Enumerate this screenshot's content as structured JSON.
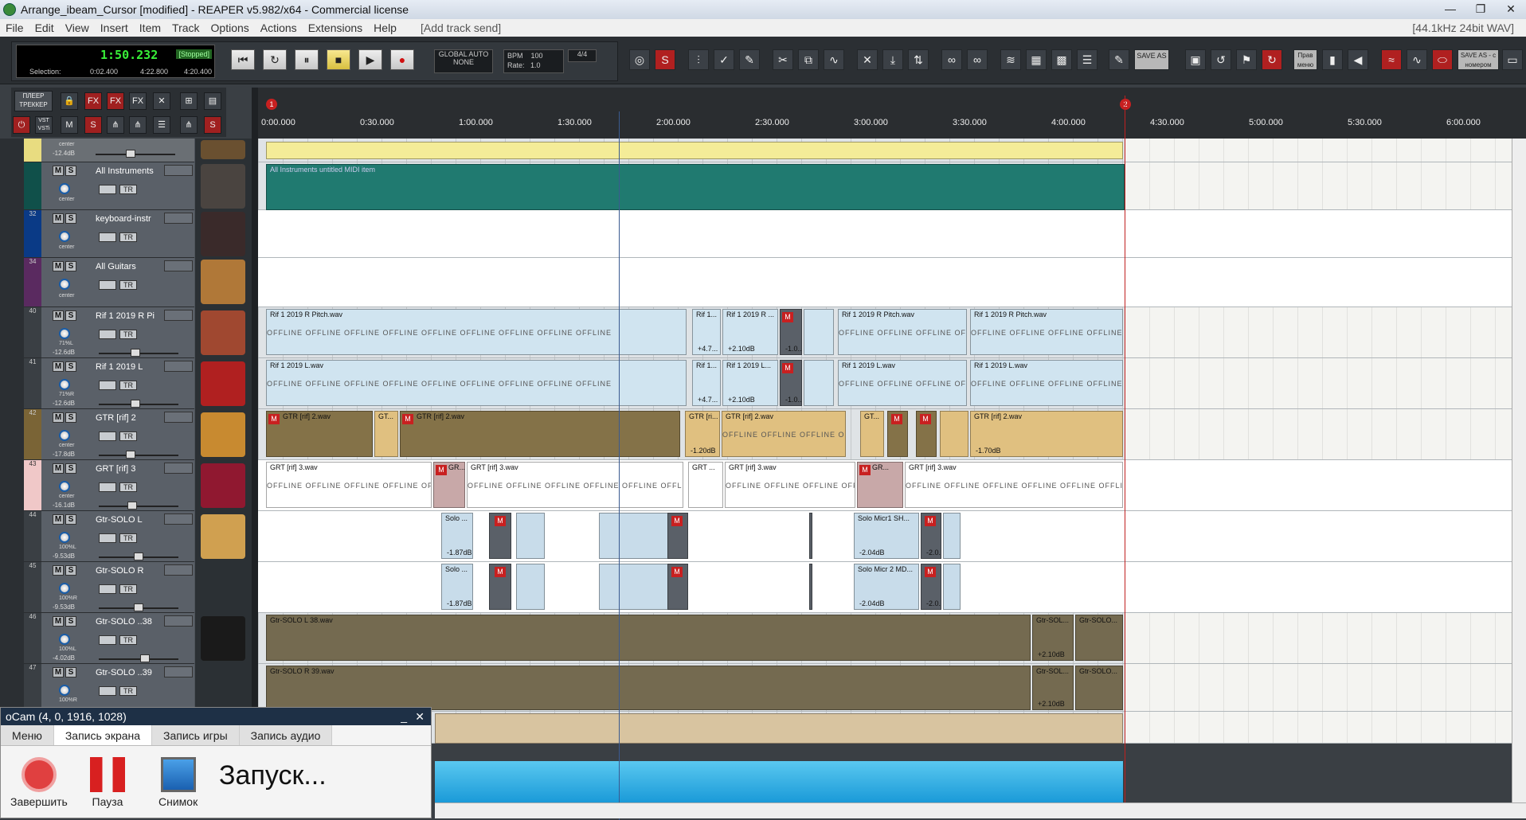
{
  "window": {
    "title": "Arrange_ibeam_Cursor [modified] - REAPER v5.982/x64 - Commercial license",
    "controls": [
      "—",
      "❐",
      "✕"
    ]
  },
  "menu": {
    "items": [
      "File",
      "Edit",
      "View",
      "Insert",
      "Item",
      "Track",
      "Options",
      "Actions",
      "Extensions",
      "Help"
    ],
    "send": "[Add track send]",
    "format": "[44.1kHz 24bit WAV]"
  },
  "transport": {
    "time": "1:50.232",
    "state": "[Stopped]",
    "sel_label": "Selection:",
    "sel_start": "0:02.400",
    "sel_end": "4:22.800",
    "sel_len": "4:20.400",
    "global_auto": "GLOBAL AUTO",
    "auto_mode": "NONE",
    "bpm_label": "BPM",
    "bpm": "100",
    "rate_label": "Rate:",
    "rate": "1.0",
    "signature": "4/4"
  },
  "toolbar": {
    "save_as": "SAVE AS",
    "prev_menu": "Прав меню",
    "save_as_num": "SAVE AS - с номером"
  },
  "lefttools": {
    "tracker": "ПЛЕЕР ТРЕККЕР",
    "vsti": "VST VSTi"
  },
  "ruler": {
    "marks": [
      "0:00.000",
      "0:30.000",
      "1:00.000",
      "1:30.000",
      "2:00.000",
      "2:30.000",
      "3:00.000",
      "3:30.000",
      "4:00.000",
      "4:30.000",
      "5:00.000",
      "5:30.000",
      "6:00.000"
    ],
    "marker1": "1",
    "marker2": "2"
  },
  "tracks": [
    {
      "num": "",
      "name": "",
      "pan": "center",
      "vol": "-12.4dB"
    },
    {
      "num": "",
      "name": "All Instruments",
      "pan": "center",
      "vol": ""
    },
    {
      "num": "32",
      "name": "keyboard-instr",
      "pan": "center",
      "vol": ""
    },
    {
      "num": "34",
      "name": "All Guitars",
      "pan": "center",
      "vol": ""
    },
    {
      "num": "40",
      "name": "Rif 1 2019 R Pi",
      "pan": "71%L",
      "vol": "-12.6dB"
    },
    {
      "num": "41",
      "name": "Rif 1 2019 L",
      "pan": "71%R",
      "vol": "-12.6dB"
    },
    {
      "num": "42",
      "name": "GTR [rif]  2",
      "pan": "center",
      "vol": "-17.8dB"
    },
    {
      "num": "43",
      "name": "GRT [rif]  3",
      "pan": "center",
      "vol": "-16.1dB"
    },
    {
      "num": "44",
      "name": "Gtr-SOLO  L",
      "pan": "100%L",
      "vol": "-9.53dB"
    },
    {
      "num": "45",
      "name": "Gtr-SOLO  R",
      "pan": "100%R",
      "vol": "-9.53dB"
    },
    {
      "num": "46",
      "name": "Gtr-SOLO  ..38",
      "pan": "100%L",
      "vol": "-4.02dB"
    },
    {
      "num": "47",
      "name": "Gtr-SOLO  ..39",
      "pan": "100%R",
      "vol": ""
    }
  ],
  "ms": {
    "m": "M",
    "s": "S",
    "tr": "TR"
  },
  "items": {
    "midi": "All Instruments untitled MIDI item",
    "rif_r": "Rif 1 2019 R Pitch.wav",
    "rif_r_short1": "Rif 1...",
    "rif_r_short2": "Rif 1 2019 R ...",
    "rif_l": "Rif 1 2019 L.wav",
    "rif_l_short1": "Rif 1...",
    "rif_l_short2": "Rif 1 2019 L...",
    "gtr2": "GTR [rif]  2.wav",
    "gtr2_short": "GT...",
    "gtr2_short2": "GTR [ri...",
    "grt3": "GRT [rif]  3.wav",
    "grt3_short": "GRT ...",
    "gr_short": "GR...",
    "solo_l": "Solo Micr1 SH...",
    "solo_r": "Solo Micr 2 MD...",
    "solo_short": "Solo ...",
    "solo38": "Gtr-SOLO  L 38.wav",
    "solo39": "Gtr-SOLO  R 39.wav",
    "solo_short2": "Gtr-SOL...",
    "solo_short3": "Gtr-SOLO...",
    "offline": "OFFLINE    OFFLINE    OFFLINE    OFFLINE    OFFLINE    OFFLINE    OFFLINE    OFFLINE    OFFLINE",
    "db_a": "+4.7...",
    "db_b": "+2.10dB",
    "db_c": "-1.0...",
    "db_d": "-1.20dB",
    "db_e": "-1.70dB",
    "db_f": "-1.87dB",
    "db_g": "-2.04dB",
    "db_h": "-2.0...",
    "db_i": "+2.10dB",
    "mute": "M"
  },
  "ocam": {
    "title": "oCam (4, 0, 1916, 1028)",
    "minimize": "_",
    "close": "✕",
    "tabs": [
      "Меню",
      "Запись экрана",
      "Запись игры",
      "Запись аудио"
    ],
    "stop": "Завершить",
    "pause": "Пауза",
    "snapshot": "Снимок",
    "starting": "Запуск..."
  }
}
